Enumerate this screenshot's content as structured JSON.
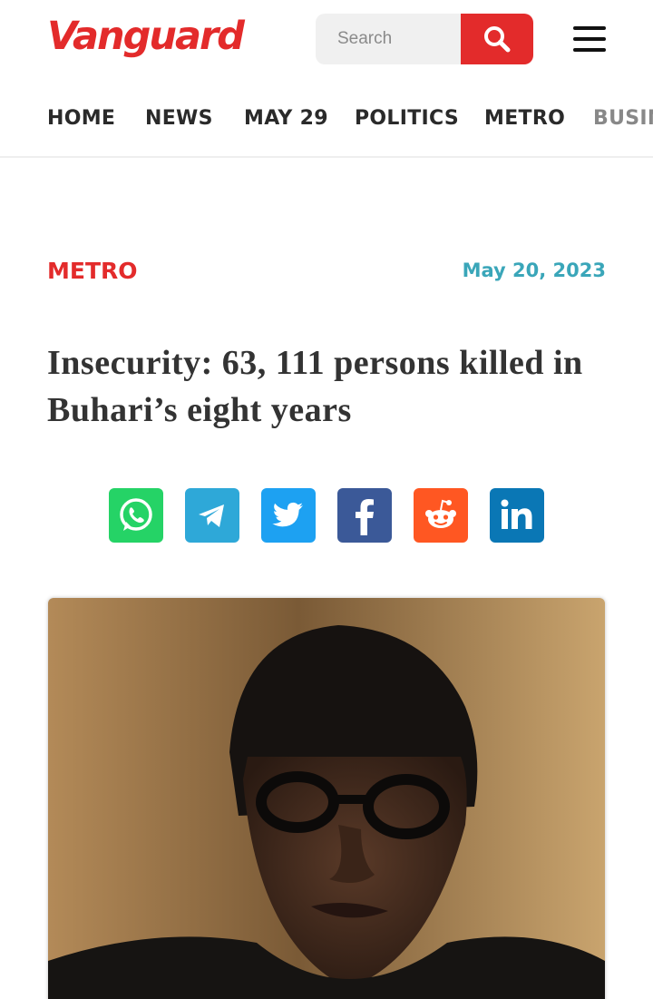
{
  "header": {
    "logo_text": "Vanguard",
    "search_placeholder": "Search",
    "brand_color": "#e32b2b"
  },
  "nav": {
    "items": [
      "HOME",
      "NEWS",
      "MAY 29",
      "POLITICS",
      "METRO",
      "BUSINESS"
    ]
  },
  "article": {
    "category": "METRO",
    "date": "May 20, 2023",
    "title": "Insecurity: 63, 111 persons killed in Buhari’s eight years"
  },
  "share": {
    "buttons": [
      {
        "name": "whatsapp",
        "icon": "whatsapp-icon",
        "color": "#25d366"
      },
      {
        "name": "telegram",
        "icon": "telegram-icon",
        "color": "#2ea8d8"
      },
      {
        "name": "twitter",
        "icon": "twitter-icon",
        "color": "#1da1f2"
      },
      {
        "name": "facebook",
        "icon": "facebook-icon",
        "color": "#3b5998"
      },
      {
        "name": "reddit",
        "icon": "reddit-icon",
        "color": "#ff5722"
      },
      {
        "name": "linkedin",
        "icon": "linkedin-icon",
        "color": "#0a77b5"
      }
    ]
  },
  "colors": {
    "accent": "#e32b2b",
    "date": "#3aa6b9"
  }
}
